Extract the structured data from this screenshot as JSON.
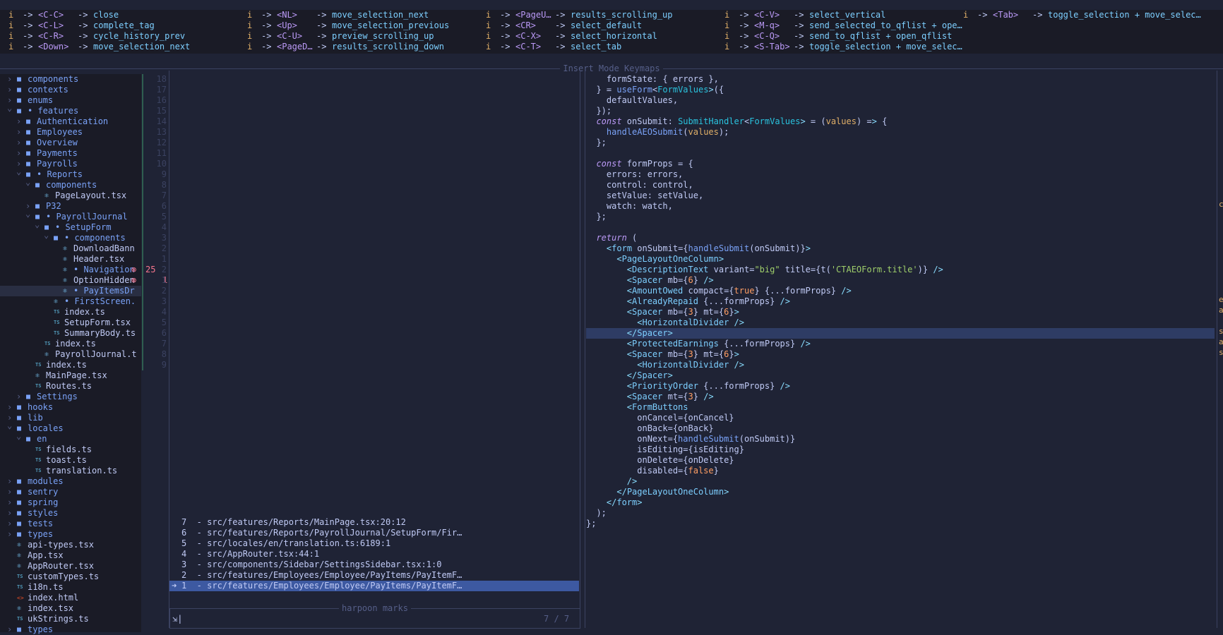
{
  "keymaps": {
    "title": "Insert Mode Keymaps",
    "columns": [
      [
        {
          "mode": "i",
          "key": "<C-C>",
          "action": "close"
        },
        {
          "mode": "i",
          "key": "<C-L>",
          "action": "complete_tag"
        },
        {
          "mode": "i",
          "key": "<C-R>",
          "action": "cycle_history_prev"
        },
        {
          "mode": "i",
          "key": "<Down>",
          "action": "move_selection_next"
        }
      ],
      [
        {
          "mode": "i",
          "key": "<NL>",
          "action": "move_selection_next"
        },
        {
          "mode": "i",
          "key": "<Up>",
          "action": "move_selection_previous"
        },
        {
          "mode": "i",
          "key": "<C-U>",
          "action": "preview_scrolling_up"
        },
        {
          "mode": "i",
          "key": "<PageD…",
          "action": "results_scrolling_down"
        }
      ],
      [
        {
          "mode": "i",
          "key": "<PageU…",
          "action": "results_scrolling_up"
        },
        {
          "mode": "i",
          "key": "<CR>",
          "action": "select_default"
        },
        {
          "mode": "i",
          "key": "<C-X>",
          "action": "select_horizontal"
        },
        {
          "mode": "i",
          "key": "<C-T>",
          "action": "select_tab"
        }
      ],
      [
        {
          "mode": "i",
          "key": "<C-V>",
          "action": "select_vertical"
        },
        {
          "mode": "i",
          "key": "<M-q>",
          "action": "send_selected_to_qflist + ope…"
        },
        {
          "mode": "i",
          "key": "<C-Q>",
          "action": "send_to_qflist + open_qflist"
        },
        {
          "mode": "i",
          "key": "<S-Tab>",
          "action": "toggle_selection + move_selec…"
        }
      ],
      [
        {
          "mode": "i",
          "key": "<Tab>",
          "action": "toggle_selection + move_selec…"
        }
      ]
    ]
  },
  "tree": [
    {
      "depth": 0,
      "type": "dir",
      "name": "components",
      "open": false
    },
    {
      "depth": 0,
      "type": "dir",
      "name": "contexts",
      "open": false
    },
    {
      "depth": 0,
      "type": "dir",
      "name": "enums",
      "open": false
    },
    {
      "depth": 0,
      "type": "dir",
      "name": "• features",
      "open": true,
      "mod": true
    },
    {
      "depth": 1,
      "type": "dir",
      "name": "Authentication",
      "open": false
    },
    {
      "depth": 1,
      "type": "dir",
      "name": "Employees",
      "open": false
    },
    {
      "depth": 1,
      "type": "dir",
      "name": "Overview",
      "open": false
    },
    {
      "depth": 1,
      "type": "dir",
      "name": "Payments",
      "open": false
    },
    {
      "depth": 1,
      "type": "dir",
      "name": "Payrolls",
      "open": false
    },
    {
      "depth": 1,
      "type": "dir",
      "name": "• Reports",
      "open": true,
      "mod": true
    },
    {
      "depth": 2,
      "type": "dir",
      "name": "components",
      "open": true
    },
    {
      "depth": 3,
      "type": "tsx",
      "name": "PageLayout.tsx"
    },
    {
      "depth": 2,
      "type": "dir",
      "name": "P32",
      "open": false
    },
    {
      "depth": 2,
      "type": "dir",
      "name": "• PayrollJournal",
      "open": true,
      "mod": true
    },
    {
      "depth": 3,
      "type": "dir",
      "name": "• SetupForm",
      "open": true,
      "mod": true
    },
    {
      "depth": 4,
      "type": "dir",
      "name": "• components",
      "open": true,
      "mod": true
    },
    {
      "depth": 5,
      "type": "tsx",
      "name": "DownloadBann"
    },
    {
      "depth": 5,
      "type": "tsx",
      "name": "Header.tsx"
    },
    {
      "depth": 5,
      "type": "tsx",
      "name": "• Navigation",
      "mod": true,
      "diag": "25"
    },
    {
      "depth": 5,
      "type": "tsx",
      "name": "OptionHidden",
      "diag": "1"
    },
    {
      "depth": 5,
      "type": "tsx",
      "name": "• PayItemsDr",
      "mod": true,
      "sel": true
    },
    {
      "depth": 4,
      "type": "tsx",
      "name": "• FirstScreen.",
      "mod": true
    },
    {
      "depth": 4,
      "type": "ts",
      "name": "index.ts"
    },
    {
      "depth": 4,
      "type": "ts",
      "name": "SetupForm.tsx"
    },
    {
      "depth": 4,
      "type": "ts",
      "name": "SummaryBody.ts"
    },
    {
      "depth": 3,
      "type": "ts",
      "name": "index.ts"
    },
    {
      "depth": 3,
      "type": "tsx",
      "name": "PayrollJournal.t"
    },
    {
      "depth": 2,
      "type": "ts",
      "name": "index.ts"
    },
    {
      "depth": 2,
      "type": "tsx",
      "name": "MainPage.tsx"
    },
    {
      "depth": 2,
      "type": "ts",
      "name": "Routes.ts"
    },
    {
      "depth": 1,
      "type": "dir",
      "name": "Settings",
      "open": false
    },
    {
      "depth": 0,
      "type": "dir",
      "name": "hooks",
      "open": false
    },
    {
      "depth": 0,
      "type": "dir",
      "name": "lib",
      "open": false
    },
    {
      "depth": 0,
      "type": "dir",
      "name": "locales",
      "open": true
    },
    {
      "depth": 1,
      "type": "dir",
      "name": "en",
      "open": true
    },
    {
      "depth": 2,
      "type": "ts",
      "name": "fields.ts"
    },
    {
      "depth": 2,
      "type": "ts",
      "name": "toast.ts"
    },
    {
      "depth": 2,
      "type": "ts",
      "name": "translation.ts"
    },
    {
      "depth": 0,
      "type": "dir",
      "name": "modules",
      "open": false
    },
    {
      "depth": 0,
      "type": "dir",
      "name": "sentry",
      "open": false
    },
    {
      "depth": 0,
      "type": "dir",
      "name": "spring",
      "open": false
    },
    {
      "depth": 0,
      "type": "dir",
      "name": "styles",
      "open": false
    },
    {
      "depth": 0,
      "type": "dir",
      "name": "tests",
      "open": false
    },
    {
      "depth": 0,
      "type": "dir",
      "name": "types",
      "open": false
    },
    {
      "depth": 0,
      "type": "tsx",
      "name": "api-types.tsx"
    },
    {
      "depth": 0,
      "type": "tsx",
      "name": "App.tsx"
    },
    {
      "depth": 0,
      "type": "tsx",
      "name": "AppRouter.tsx"
    },
    {
      "depth": 0,
      "type": "ts",
      "name": "customTypes.ts"
    },
    {
      "depth": 0,
      "type": "ts",
      "name": "i18n.ts"
    },
    {
      "depth": 0,
      "type": "html",
      "name": "index.html"
    },
    {
      "depth": 0,
      "type": "tsx",
      "name": "index.tsx"
    },
    {
      "depth": 0,
      "type": "ts",
      "name": "ukStrings.ts"
    },
    {
      "depth": 0,
      "type": "dir",
      "name": "types",
      "open": false
    }
  ],
  "line_numbers": [
    "18",
    "17",
    "16",
    "15",
    "14",
    "13",
    "12",
    "11",
    "10",
    "9",
    "8",
    "7",
    "6",
    "5",
    "4",
    "3",
    "2",
    "1",
    "2",
    "1",
    "2",
    "3",
    "4",
    "5",
    "6",
    "7",
    "8",
    "9"
  ],
  "harpoon": {
    "title": "harpoon marks",
    "count": "7 / 7",
    "prompt_icon": "⇲",
    "marks": [
      "7  - src/features/Reports/MainPage.tsx:20:12",
      "6  - src/features/Reports/PayrollJournal/SetupForm/Fir…",
      "5  - src/locales/en/translation.ts:6189:1",
      "4  - src/AppRouter.tsx:44:1",
      "3  - src/components/Sidebar/SettingsSidebar.tsx:1:0",
      "2  - src/features/Employees/Employee/PayItems/PayItemF…",
      "1  - src/features/Employees/Employee/PayItems/PayItemF…"
    ],
    "selected_marker": "➜"
  },
  "code": [
    "    formState: { errors },",
    "  } = useForm<FormValues>({",
    "    defaultValues,",
    "  });",
    "  const onSubmit: SubmitHandler<FormValues> = (values) => {",
    "    handleAEOSubmit(values);",
    "  };",
    "",
    "  const formProps = {",
    "    errors: errors,",
    "    control: control,",
    "    setValue: setValue,",
    "    watch: watch,",
    "  };",
    "",
    "  return (",
    "    <form onSubmit={handleSubmit(onSubmit)}>",
    "      <PageLayoutOneColumn>",
    "        <DescriptionText variant=\"big\" title={t('CTAEOForm.title')} />",
    "        <Spacer mb={6} />",
    "        <AmountOwed compact={true} {...formProps} />",
    "        <AlreadyRepaid {...formProps} />",
    "        <Spacer mb={3} mt={6}>",
    "          <HorizontalDivider />",
    "        </Spacer>",
    "        <ProtectedEarnings {...formProps} />",
    "        <Spacer mb={3} mt={6}>",
    "          <HorizontalDivider />",
    "        </Spacer>",
    "        <PriorityOrder {...formProps} />",
    "        <Spacer mt={3} />",
    "        <FormButtons",
    "          onCancel={onCancel}",
    "          onBack={onBack}",
    "          onNext={handleSubmit(onSubmit)}",
    "          isEditing={isEditing}",
    "          onDelete={onDelete}",
    "          disabled={false}",
    "        />",
    "      </PageLayoutOneColumn>",
    "    </form>",
    "  );",
    "};"
  ],
  "code_highlight_line": 24,
  "right_edge_chars": [
    "c",
    "",
    "",
    "",
    "",
    "",
    "",
    "",
    "",
    "e",
    "a",
    "",
    "s",
    "a",
    "s"
  ],
  "colors": {
    "background": "#1f2335",
    "panel": "#1a1b26",
    "accent": "#7aa2f7",
    "selection": "#3d59a1",
    "error": "#f7768e"
  }
}
